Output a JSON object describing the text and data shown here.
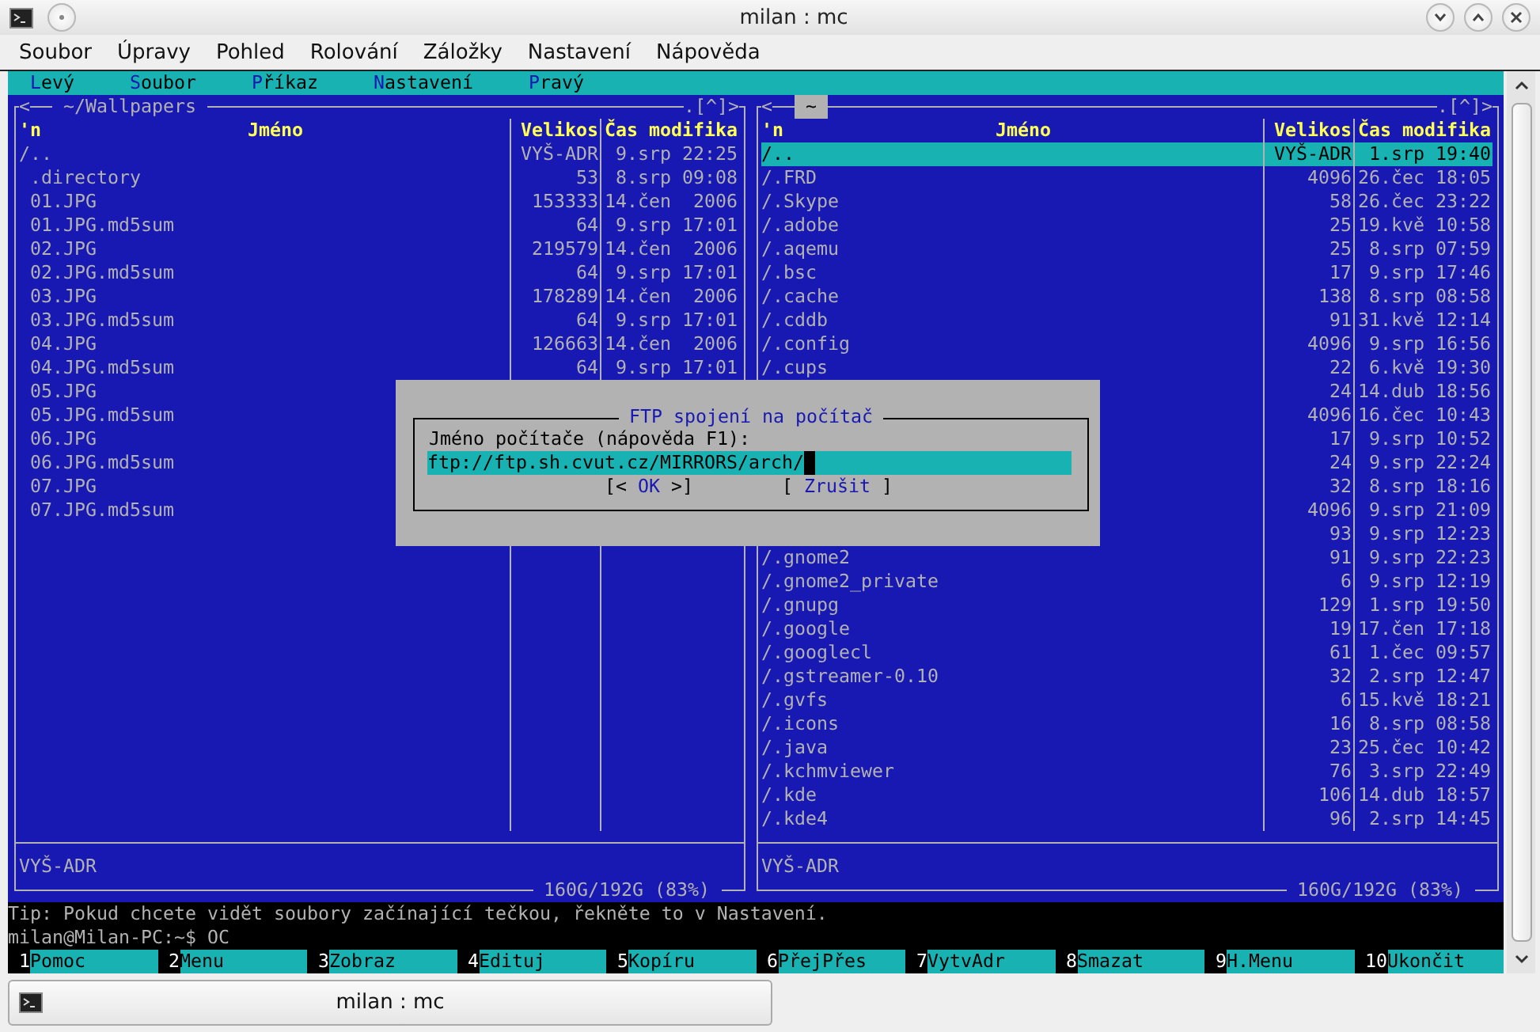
{
  "window": {
    "title": "milan : mc"
  },
  "menubar": [
    "Soubor",
    "Úpravy",
    "Pohled",
    "Rolování",
    "Záložky",
    "Nastavení",
    "Nápověda"
  ],
  "mc_menu": [
    {
      "hotkey": "L",
      "rest": "evý"
    },
    {
      "hotkey": "S",
      "rest": "oubor"
    },
    {
      "hotkey": "P",
      "rest": "říkaz"
    },
    {
      "hotkey": "N",
      "rest": "astavení"
    },
    {
      "hotkey": "P",
      "rest": "ravý"
    }
  ],
  "panels": [
    {
      "path": "~/Wallpapers",
      "active": false,
      "nav_left": "<",
      "nav_right": ">",
      "history": ".[^]",
      "columns": [
        "'n",
        "Jméno",
        "Velikos",
        "Čas modifika"
      ],
      "rows": [
        {
          "kind": "dir",
          "name": "/..",
          "size": "VYŠ-ADR",
          "time": "9.srp 22:25",
          "selected": false
        },
        {
          "kind": "file",
          "name": ".directory",
          "size": "53",
          "time": "8.srp 09:08",
          "selected": false
        },
        {
          "kind": "file",
          "name": "01.JPG",
          "size": "153333",
          "time": "14.čen  2006",
          "selected": false
        },
        {
          "kind": "file",
          "name": "01.JPG.md5sum",
          "size": "64",
          "time": "9.srp 17:01",
          "selected": false
        },
        {
          "kind": "file",
          "name": "02.JPG",
          "size": "219579",
          "time": "14.čen  2006",
          "selected": false
        },
        {
          "kind": "file",
          "name": "02.JPG.md5sum",
          "size": "64",
          "time": "9.srp 17:01",
          "selected": false
        },
        {
          "kind": "file",
          "name": "03.JPG",
          "size": "178289",
          "time": "14.čen  2006",
          "selected": false
        },
        {
          "kind": "file",
          "name": "03.JPG.md5sum",
          "size": "64",
          "time": "9.srp 17:01",
          "selected": false
        },
        {
          "kind": "file",
          "name": "04.JPG",
          "size": "126663",
          "time": "14.čen  2006",
          "selected": false
        },
        {
          "kind": "file",
          "name": "04.JPG.md5sum",
          "size": "64",
          "time": "9.srp 17:01",
          "selected": false
        },
        {
          "kind": "file",
          "name": "05.JPG",
          "selected": false
        },
        {
          "kind": "file",
          "name": "05.JPG.md5sum",
          "selected": false
        },
        {
          "kind": "file",
          "name": "06.JPG",
          "selected": false
        },
        {
          "kind": "file",
          "name": "06.JPG.md5sum",
          "selected": false
        },
        {
          "kind": "file",
          "name": "07.JPG",
          "selected": false
        },
        {
          "kind": "file",
          "name": "07.JPG.md5sum",
          "selected": false
        }
      ],
      "status": "VYŠ-ADR",
      "free": "160G/192G (83%)"
    },
    {
      "path": "~",
      "active": true,
      "nav_left": "<",
      "nav_right": ">",
      "history": ".[^]",
      "columns": [
        "'n",
        "Jméno",
        "Velikos",
        "Čas modifika"
      ],
      "rows": [
        {
          "kind": "dir",
          "name": "/..",
          "size": "VYŠ-ADR",
          "time": "1.srp 19:40",
          "selected": true
        },
        {
          "kind": "dir",
          "name": "/.FRD",
          "size": "4096",
          "time": "26.čec 18:05",
          "selected": false
        },
        {
          "kind": "dir",
          "name": "/.Skype",
          "size": "58",
          "time": "26.čec 23:22",
          "selected": false
        },
        {
          "kind": "dir",
          "name": "/.adobe",
          "size": "25",
          "time": "19.kvě 10:58",
          "selected": false
        },
        {
          "kind": "dir",
          "name": "/.aqemu",
          "size": "25",
          "time": "8.srp 07:59",
          "selected": false
        },
        {
          "kind": "dir",
          "name": "/.bsc",
          "size": "17",
          "time": "9.srp 17:46",
          "selected": false
        },
        {
          "kind": "dir",
          "name": "/.cache",
          "size": "138",
          "time": "8.srp 08:58",
          "selected": false
        },
        {
          "kind": "dir",
          "name": "/.cddb",
          "size": "91",
          "time": "31.kvě 12:14",
          "selected": false
        },
        {
          "kind": "dir",
          "name": "/.config",
          "size": "4096",
          "time": "9.srp 16:56",
          "selected": false
        },
        {
          "kind": "dir",
          "name": "/.cups",
          "size": "22",
          "time": "6.kvě 19:30",
          "selected": false
        },
        {
          "kind": "dir",
          "size": "24",
          "time": "14.dub 18:56",
          "selected": false
        },
        {
          "kind": "dir",
          "size": "4096",
          "time": "16.čec 10:43",
          "selected": false
        },
        {
          "kind": "dir",
          "size": "17",
          "time": "9.srp 10:52",
          "selected": false
        },
        {
          "kind": "dir",
          "size": "24",
          "time": "9.srp 22:24",
          "selected": false
        },
        {
          "kind": "dir",
          "size": "32",
          "time": "8.srp 18:16",
          "selected": false
        },
        {
          "kind": "dir",
          "size": "4096",
          "time": "9.srp 21:09",
          "selected": false
        },
        {
          "kind": "dir",
          "size": "93",
          "time": "9.srp 12:23",
          "selected": false
        },
        {
          "kind": "dir",
          "name": "/.gnome2",
          "size": "91",
          "time": "9.srp 22:23",
          "selected": false
        },
        {
          "kind": "dir",
          "name": "/.gnome2_private",
          "size": "6",
          "time": "9.srp 12:19",
          "selected": false
        },
        {
          "kind": "dir",
          "name": "/.gnupg",
          "size": "129",
          "time": "1.srp 19:50",
          "selected": false
        },
        {
          "kind": "dir",
          "name": "/.google",
          "size": "19",
          "time": "17.čen 17:18",
          "selected": false
        },
        {
          "kind": "dir",
          "name": "/.googlecl",
          "size": "61",
          "time": "1.čec 09:57",
          "selected": false
        },
        {
          "kind": "dir",
          "name": "/.gstreamer-0.10",
          "size": "32",
          "time": "2.srp 12:47",
          "selected": false
        },
        {
          "kind": "dir",
          "name": "/.gvfs",
          "size": "6",
          "time": "15.kvě 18:21",
          "selected": false
        },
        {
          "kind": "dir",
          "name": "/.icons",
          "size": "16",
          "time": "8.srp 08:58",
          "selected": false
        },
        {
          "kind": "dir",
          "name": "/.java",
          "size": "23",
          "time": "25.čec 10:42",
          "selected": false
        },
        {
          "kind": "dir",
          "name": "/.kchmviewer",
          "size": "76",
          "time": "3.srp 22:49",
          "selected": false
        },
        {
          "kind": "dir",
          "name": "/.kde",
          "size": "106",
          "time": "14.dub 18:57",
          "selected": false
        },
        {
          "kind": "dir",
          "name": "/.kde4",
          "size": "96",
          "time": "2.srp 14:45",
          "selected": false
        }
      ],
      "status": "VYŠ-ADR",
      "free": "160G/192G (83%)"
    }
  ],
  "tip": "Tip: Pokud chcete vidět soubory začínající tečkou, řekněte to v Nastavení.",
  "prompt": "milan@Milan-PC:~$ OC",
  "keybar": [
    {
      "key": "1",
      "label": "Pomoc"
    },
    {
      "key": "2",
      "label": "Menu"
    },
    {
      "key": "3",
      "label": "Zobraz"
    },
    {
      "key": "4",
      "label": "Edituj"
    },
    {
      "key": "5",
      "label": "Kopíru"
    },
    {
      "key": "6",
      "label": "PřejPřes"
    },
    {
      "key": "7",
      "label": "VytvAdr"
    },
    {
      "key": "8",
      "label": "Smazat"
    },
    {
      "key": "9",
      "label": "H.Menu"
    },
    {
      "key": "10",
      "label": "Ukončit"
    }
  ],
  "dialog": {
    "title": "FTP spojení na počítač",
    "label": "Jméno počítače (nápověda F1):",
    "value": "ftp://ftp.sh.cvut.cz/MIRRORS/arch/",
    "focused": true,
    "buttons": [
      {
        "open": "[<",
        "label": "OK",
        "close": ">]"
      },
      {
        "open": "[",
        "label": "Zrušit",
        "close": "]"
      }
    ]
  },
  "tabs": [
    {
      "label": "milan : mc",
      "selected": true
    }
  ]
}
